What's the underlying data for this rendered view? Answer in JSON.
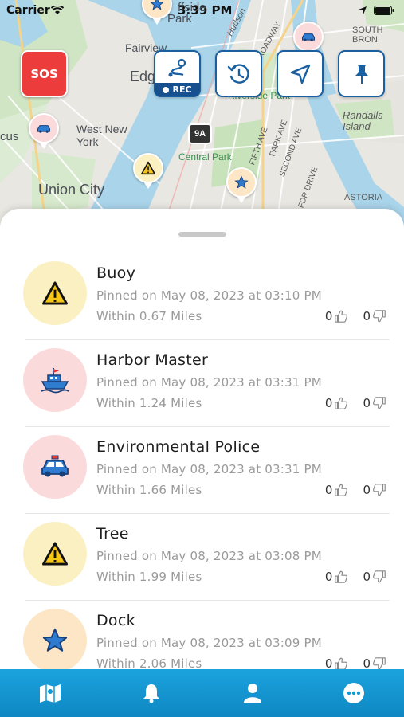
{
  "status_bar": {
    "carrier": "Carrier",
    "time": "3:39 PM"
  },
  "map": {
    "labels": {
      "fairview": "Fairview",
      "edgewater": "Edg",
      "west_new_york": "West New\nYork",
      "union_city": "Union City",
      "cus": "cus",
      "park_top": "Park",
      "riverside_park": "Riverside Park",
      "central_park": "Central Park",
      "randalls_island": "Randalls\nIsland",
      "astoria": "ASTORIA",
      "south_bronx": "SOUTH BRON",
      "hudson_pkwy": "Hudson",
      "broadway": "BROADWAY",
      "fifth_ave": "FIFTH AVE",
      "park_ave": "PARK AVE",
      "second_ave": "SECOND AVE",
      "fdr_drive": "FDR DRIVE",
      "highway_9a": "9A",
      "affside": "ffside"
    },
    "sos_label": "SOS",
    "rec_label": "REC"
  },
  "pins": [
    {
      "title": "Buoy",
      "pinned": "Pinned on May 08, 2023 at 03:10 PM",
      "distance": "Within 0.67 Miles",
      "likes": "0",
      "dislikes": "0",
      "icon": "warning-icon",
      "bg": "#fbf0c1"
    },
    {
      "title": "Harbor Master",
      "pinned": "Pinned on May 08, 2023 at 03:31 PM",
      "distance": "Within 1.24 Miles",
      "likes": "0",
      "dislikes": "0",
      "icon": "boat-icon",
      "bg": "#fbdadc"
    },
    {
      "title": "Environmental Police",
      "pinned": "Pinned on May 08, 2023 at 03:31 PM",
      "distance": "Within 1.66 Miles",
      "likes": "0",
      "dislikes": "0",
      "icon": "police-car-icon",
      "bg": "#fbdadc"
    },
    {
      "title": "Tree",
      "pinned": "Pinned on May 08, 2023 at 03:08 PM",
      "distance": "Within 1.99 Miles",
      "likes": "0",
      "dislikes": "0",
      "icon": "warning-icon",
      "bg": "#fbf0c1"
    },
    {
      "title": "Dock",
      "pinned": "Pinned on May 08, 2023 at 03:09 PM",
      "distance": "Within 2.06 Miles",
      "likes": "0",
      "dislikes": "0",
      "icon": "star-icon",
      "bg": "#fde6c6"
    }
  ],
  "colors": {
    "accent": "#1a5fa0",
    "sos": "#ec3c3c",
    "tabbar": "#1298d4",
    "warning_bg": "#fbf0c1",
    "police_bg": "#fbdadc",
    "star_bg": "#fde6c6"
  },
  "tabs": [
    {
      "icon": "map-icon"
    },
    {
      "icon": "bell-icon"
    },
    {
      "icon": "profile-icon"
    },
    {
      "icon": "more-icon"
    }
  ]
}
